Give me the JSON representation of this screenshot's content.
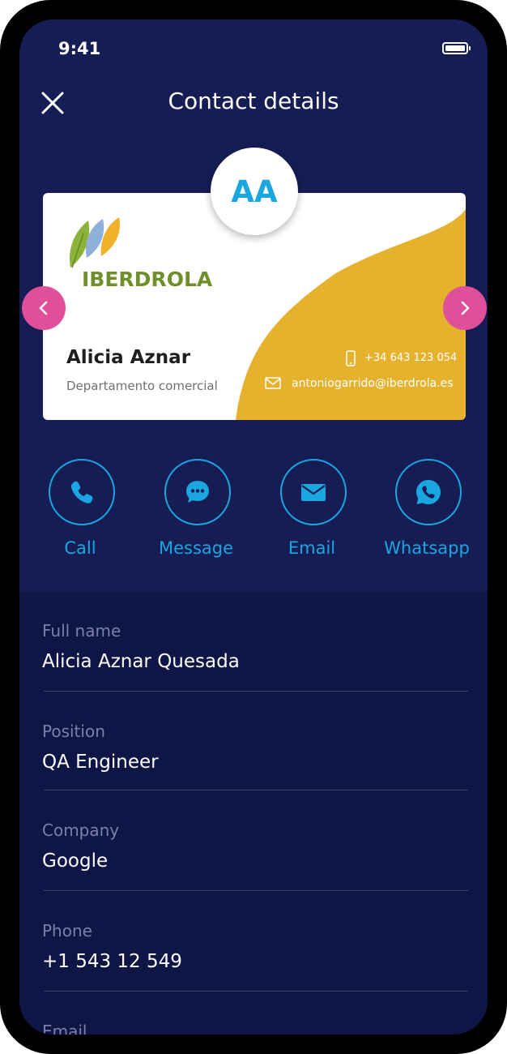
{
  "status_bar": {
    "time": "9:41"
  },
  "header": {
    "title": "Contact details"
  },
  "avatar": {
    "initials": "AA"
  },
  "card": {
    "logo_text": "IBERDROLA",
    "name": "Alicia Aznar",
    "department": "Departamento comercial",
    "phone": "+34 643 123 054",
    "email": "antoniogarrido@iberdrola.es"
  },
  "actions": [
    {
      "label": "Call",
      "icon": "phone-icon"
    },
    {
      "label": "Message",
      "icon": "chat-icon"
    },
    {
      "label": "Email",
      "icon": "envelope-icon"
    },
    {
      "label": "Whatsapp",
      "icon": "whatsapp-icon"
    }
  ],
  "fields": [
    {
      "label": "Full name",
      "value": "Alicia Aznar Quesada"
    },
    {
      "label": "Position",
      "value": "QA Engineer"
    },
    {
      "label": "Company",
      "value": "Google"
    },
    {
      "label": "Phone",
      "value": "+1 543 12 549"
    },
    {
      "label": "Email",
      "value": ""
    }
  ],
  "colors": {
    "background": "#0f1545",
    "header_background": "#161d54",
    "accent": "#1aa6e0",
    "nav_arrow": "#e0509a",
    "card_wave": "#e6b22e",
    "logo_green": "#6f8f2b"
  }
}
